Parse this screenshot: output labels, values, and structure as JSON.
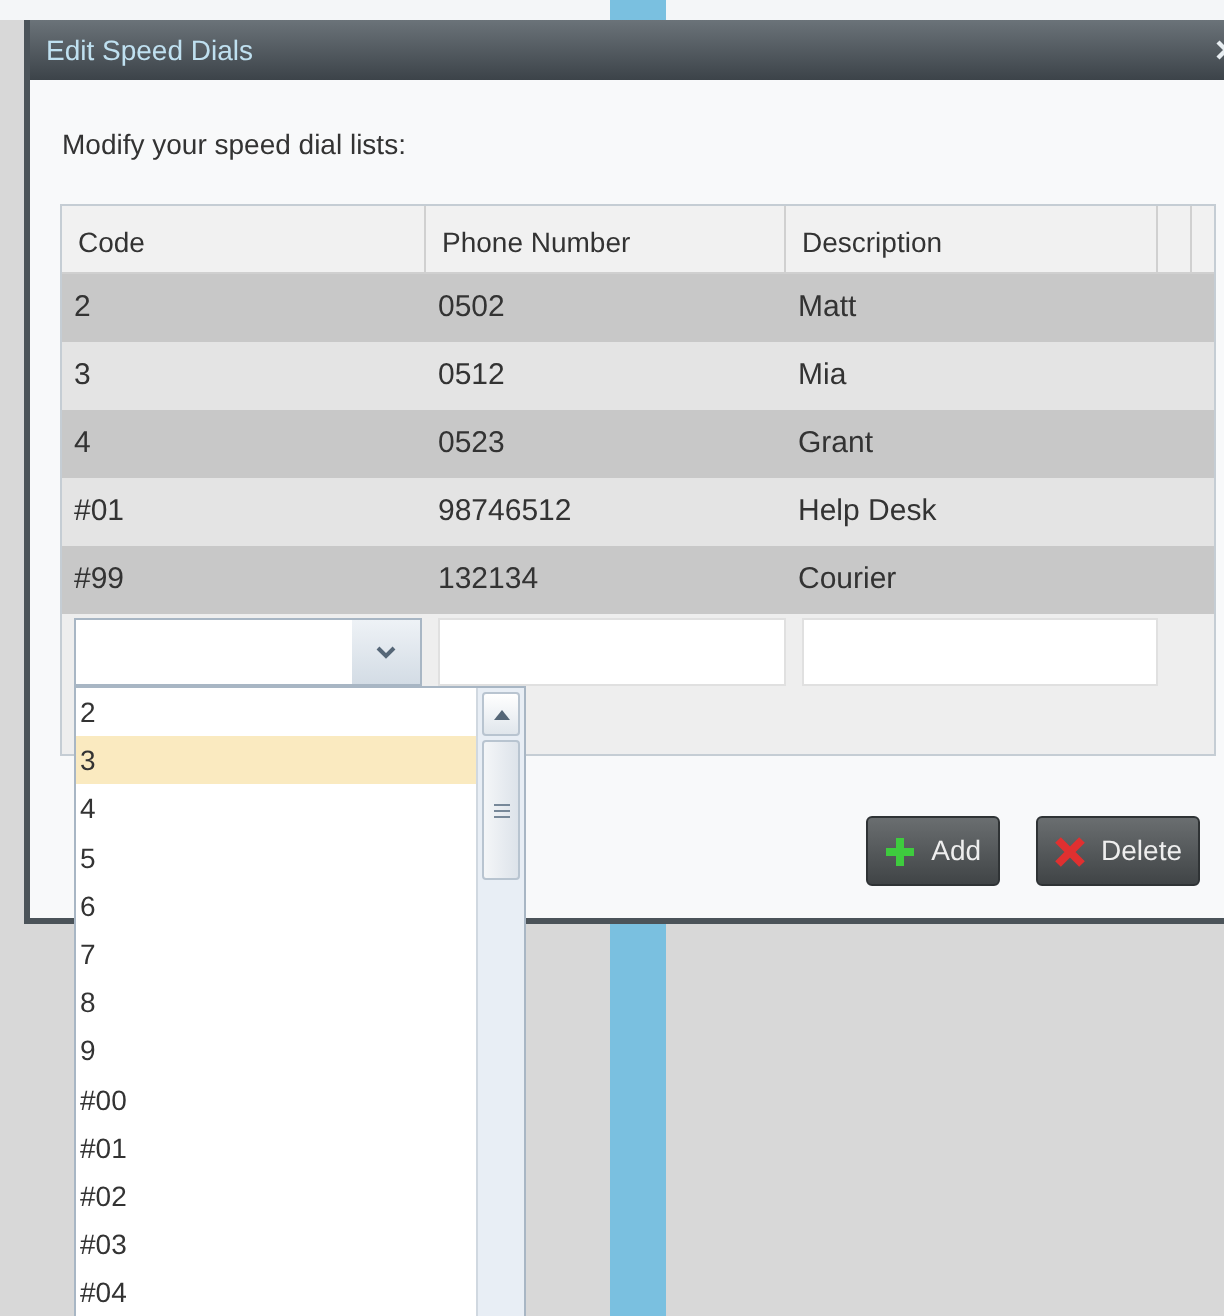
{
  "dialog": {
    "title": "Edit Speed Dials",
    "instruction": "Modify your speed dial lists:",
    "table": {
      "columns": [
        "Code",
        "Phone Number",
        "Description"
      ],
      "rows": [
        {
          "code": "2",
          "phone": "0502",
          "description": "Matt"
        },
        {
          "code": "3",
          "phone": "0512",
          "description": "Mia"
        },
        {
          "code": "4",
          "phone": "0523",
          "description": "Grant"
        },
        {
          "code": "#01",
          "phone": "98746512",
          "description": "Help Desk"
        },
        {
          "code": "#99",
          "phone": "132134",
          "description": "Courier"
        }
      ]
    },
    "code_dropdown": {
      "expanded": true,
      "options": [
        {
          "label": "2",
          "selected": false
        },
        {
          "label": "3",
          "selected": true
        },
        {
          "label": "4",
          "selected": false
        },
        {
          "label": "5",
          "selected": false
        },
        {
          "label": "6",
          "selected": false
        },
        {
          "label": "7",
          "selected": false
        },
        {
          "label": "8",
          "selected": false
        },
        {
          "label": "9",
          "selected": false
        },
        {
          "label": "#00",
          "selected": false
        },
        {
          "label": "#01",
          "selected": false
        },
        {
          "label": "#02",
          "selected": false
        },
        {
          "label": "#03",
          "selected": false
        },
        {
          "label": "#04",
          "selected": false
        }
      ]
    },
    "buttons": [
      {
        "kind": "add",
        "label": "Add"
      },
      {
        "kind": "delete",
        "label": "Delete"
      }
    ]
  }
}
